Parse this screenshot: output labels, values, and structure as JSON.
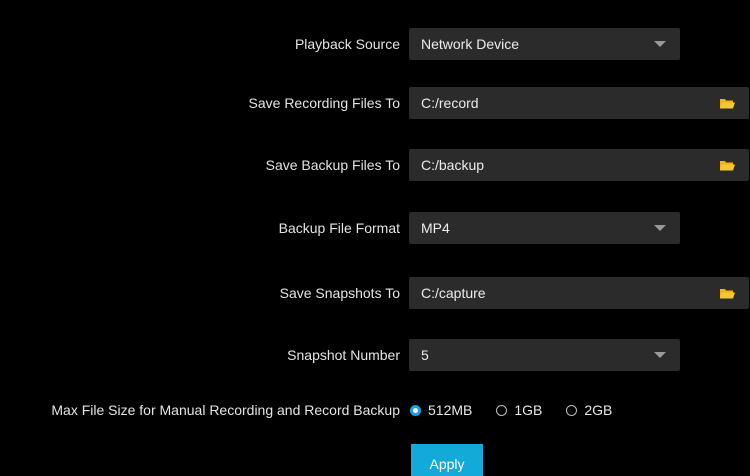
{
  "settings": {
    "playback_source": {
      "label": "Playback Source",
      "value": "Network Device"
    },
    "save_recording": {
      "label": "Save Recording Files To",
      "value": "C:/record"
    },
    "save_backup": {
      "label": "Save Backup Files To",
      "value": "C:/backup"
    },
    "backup_format": {
      "label": "Backup File Format",
      "value": "MP4"
    },
    "save_snapshots": {
      "label": "Save Snapshots To",
      "value": "C:/capture"
    },
    "snapshot_number": {
      "label": "Snapshot Number",
      "value": "5"
    },
    "max_file_size": {
      "label": "Max File Size for Manual Recording and Record Backup",
      "options": [
        "512MB",
        "1GB",
        "2GB"
      ],
      "selected": "512MB"
    }
  },
  "apply_label": "Apply",
  "colors": {
    "background": "#000000",
    "field": "#2b2b2b",
    "accent": "#13a9d8",
    "folder": "#f2b511"
  },
  "icons": {
    "dropdown": "caret-down-icon",
    "browse": "folder-icon"
  }
}
